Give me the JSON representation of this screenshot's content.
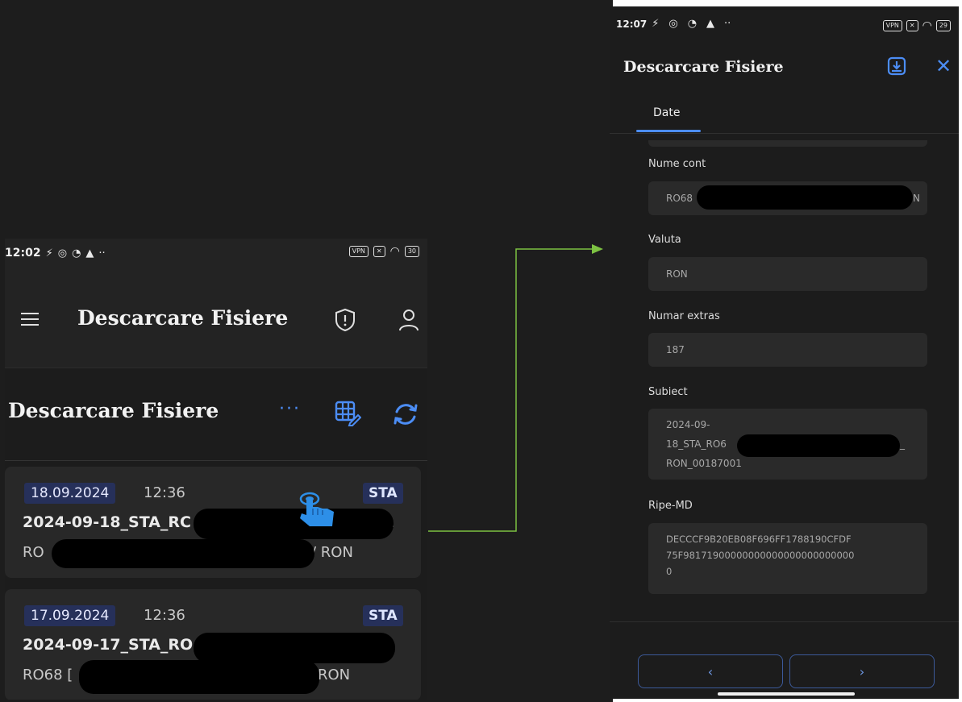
{
  "left": {
    "status": {
      "time": "12:02",
      "battery": "30"
    },
    "appbar": {
      "title": "Descarcare Fisiere"
    },
    "section": {
      "title": "Descarcare Fisiere",
      "more": "···"
    },
    "items": [
      {
        "date": "18.09.2024",
        "time": "12:36",
        "type": "STA",
        "file_name": "2024-09-18_STA_RC",
        "file_tail": ".",
        "account_prefix": "RO",
        "account_suffix": "/ RON"
      },
      {
        "date": "17.09.2024",
        "time": "12:36",
        "type": "STA",
        "file_name": "2024-09-17_STA_RO",
        "file_tail": ".",
        "account_prefix": "RO68 [",
        "account_suffix": "RON"
      }
    ]
  },
  "right": {
    "status": {
      "time": "12:07",
      "battery": "29"
    },
    "title": "Descarcare Fisiere",
    "tab": "Date",
    "fields": [
      {
        "label": "Nume cont",
        "value": "RO68",
        "value_tail": "N"
      },
      {
        "label": "Valuta",
        "value": "RON"
      },
      {
        "label": "Numar extras",
        "value": "187"
      },
      {
        "label": "Subiect",
        "value_line1": "2024-09-",
        "value_line2": "18_STA_RO6",
        "value_line2_tail": "_",
        "value_line3": "RON_00187001"
      },
      {
        "label": "Ripe-MD",
        "value": "DECCCF9B20EB08F696FF1788190CFDF\n75F98171900000000000000000000000\n0"
      }
    ],
    "nav": {
      "prev": "‹",
      "next": "›"
    }
  },
  "colors": {
    "accent": "#4c8df5",
    "chip_bg": "#26305a",
    "connector": "#7dc242"
  }
}
